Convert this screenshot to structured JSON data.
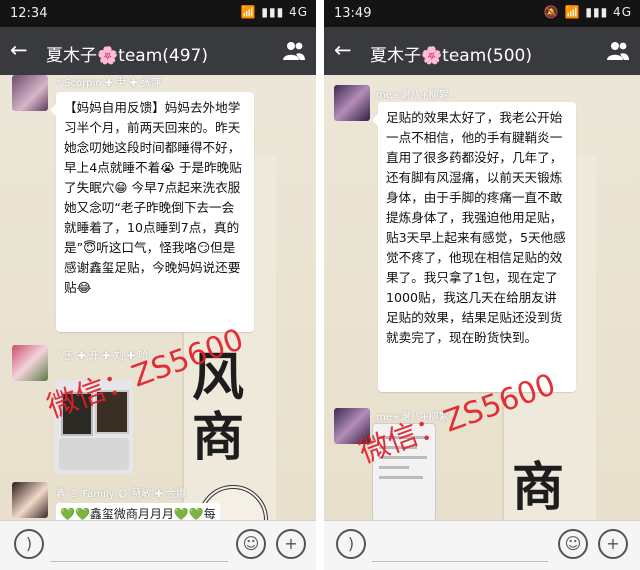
{
  "left": {
    "status": {
      "time": "12:34",
      "icons": "📶 ▮▮▮ 4G"
    },
    "header": {
      "title_pre": "夏木子",
      "flower": "🌸",
      "title_post": "team(497)"
    },
    "messages": [
      {
        "sender": "* Scorpio ✚ 尹 ✚ 张萍"
      },
      {
        "text": "【妈妈自用反馈】妈妈去外地学习半个月，前两天回来的。昨天她念叨她这段时间都睡得不好，早上4点就睡不着😭 于是昨晚贴了失眠穴😁 今早7点起来洗衣服她又念叨“老子昨晚倒下去一会就睡着了，10点睡到7点，真的是”😇听这口气，怪我咯😏但是感谢鑫玺足贴，今晚妈妈说还要贴😂"
      },
      {
        "sender": "° 玉 ✚ 开 ✚ 刘 ✚ 哈"
      },
      {
        "sender": "鑫 ® Family 😷 慧敏 ✚ 金娜"
      },
      {
        "text": "💚💚鑫玺微商月月月💚💚每"
      }
    ],
    "poster_chars": [
      "风",
      "商"
    ],
    "watermark": "微信：ZS5600"
  },
  "right": {
    "status": {
      "time": "13:49",
      "icons": "🔕 📶 ▮▮▮ 4G"
    },
    "header": {
      "title_pre": "夏木子",
      "flower": "🌸",
      "title_post": "team(500)"
    },
    "messages": [
      {
        "sender": "me+谢八+柳絮"
      },
      {
        "text": "足贴的效果太好了，我老公开始一点不相信，他的手有腱鞘炎一直用了很多药都没好，几年了，还有脚有风湿痛，以前天天锻炼身体，由于手脚的疼痛一直不敢提炼身体了，我强迫他用足贴，贴3天早上起来有感觉，5天他感觉不疼了，他现在相信足贴的效果了。我只拿了1包，现在定了1000贴，我这几天在给朋友讲足贴的效果，结果足贴还没到货就卖完了，现在盼货快到。"
      },
      {
        "sender": "me+谢八+柳絮"
      }
    ],
    "poster_chars": [
      "商"
    ],
    "watermark": "微信：ZS5600"
  },
  "icons": {
    "back": "back-arrow-icon",
    "members": "group-members-icon",
    "voice": "voice-icon",
    "emoji": "emoji-icon",
    "plus": "plus-icon"
  },
  "colors": {
    "header": "#393a3e",
    "status": "#141414",
    "watermark": "#e0202a"
  }
}
